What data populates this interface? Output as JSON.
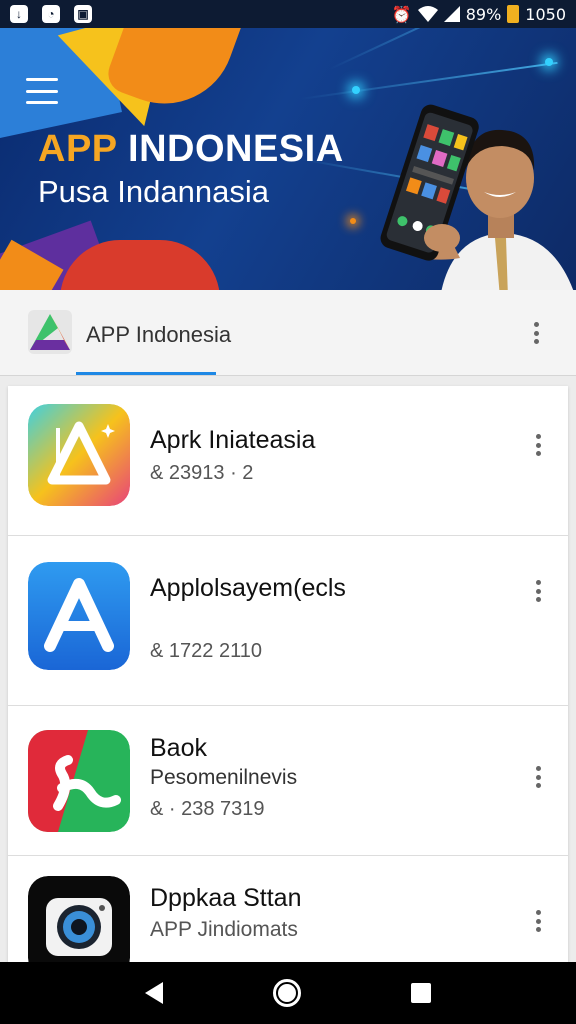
{
  "status_bar": {
    "battery": "89%",
    "time": "1050",
    "icons": [
      "download-icon",
      "notification-icon",
      "gallery-icon",
      "alarm-icon",
      "wifi-icon",
      "signal-icon",
      "battery-icon"
    ]
  },
  "hero": {
    "title_accent": "APP",
    "title_rest": " INDONESIA",
    "subtitle": "Pusa Indannasia",
    "colors": {
      "background": "#0d2a66",
      "accent": "#f6a623"
    }
  },
  "app_header": {
    "title": "APP Indonesia",
    "accent_color": "#1e88e5"
  },
  "list": {
    "items": [
      {
        "title": "Aprk Iniateasia",
        "subtitle": "",
        "meta": "& 23913 · 2",
        "icon": "delta-app-icon"
      },
      {
        "title": "Applolsayem(ecls",
        "subtitle": "",
        "meta": "& 1722 2110",
        "icon": "a-app-icon"
      },
      {
        "title": "Baok",
        "subtitle": "Pesomenilnevis",
        "meta": "& · 238 7319",
        "icon": "curl-app-icon"
      },
      {
        "title": "Dppkaa Sttan",
        "subtitle": "APP Jindiomats",
        "meta": "",
        "icon": "camera-app-icon"
      }
    ]
  }
}
